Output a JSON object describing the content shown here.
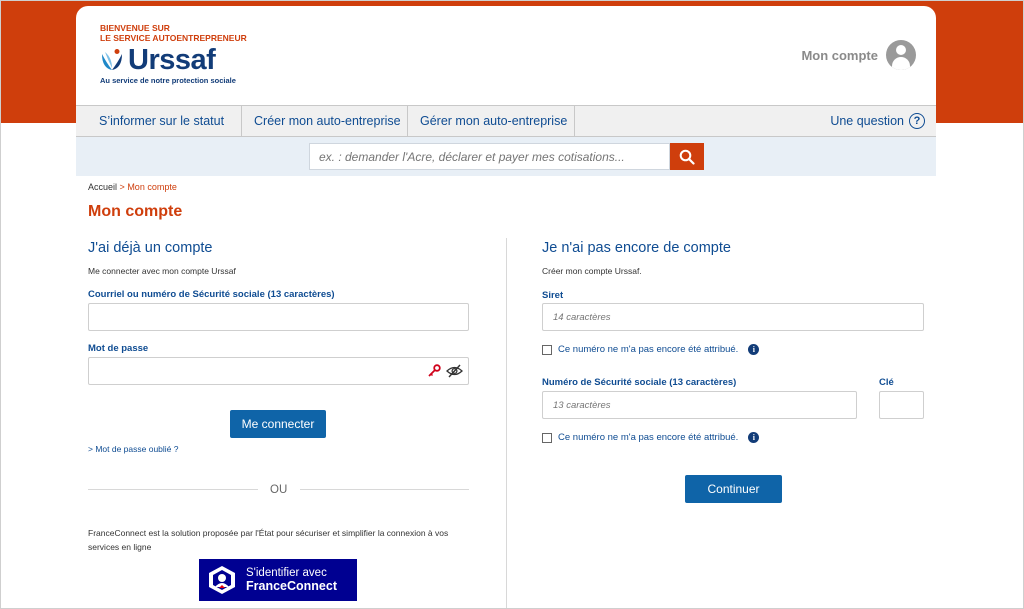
{
  "header": {
    "welcome_line1": "Bienvenue sur",
    "welcome_line2": "le service autoentrepreneur",
    "logo_text": "Urssaf",
    "tagline": "Au service de notre protection sociale",
    "account_label": "Mon compte"
  },
  "nav": {
    "items": [
      {
        "label": "S’informer sur le statut"
      },
      {
        "label": "Créer mon auto-entreprise"
      },
      {
        "label": "Gérer mon auto-entreprise"
      }
    ],
    "question_label": "Une question",
    "question_icon_glyph": "?"
  },
  "search": {
    "placeholder": "ex. : demander l'Acre, déclarer et payer mes cotisations...",
    "icon": "search-icon"
  },
  "breadcrumb": {
    "home": "Accueil",
    "separator": ">",
    "current": "Mon compte"
  },
  "page_title": "Mon compte",
  "login": {
    "heading": "J'ai déjà un compte",
    "intro": "Me connecter avec mon compte Urssaf",
    "email_label": "Courriel ou numéro de Sécurité sociale (13 caractères)",
    "email_value": "",
    "password_label": "Mot de passe",
    "password_value": "",
    "submit_label": "Me connecter",
    "forgot_link": "> Mot de passe oublié ?",
    "or_label": "OU",
    "franceconnect_text": "FranceConnect est la solution proposée par l'État pour sécuriser et simplifier la connexion à vos services en ligne",
    "franceconnect_line1": "S'identifier avec",
    "franceconnect_line2": "FranceConnect"
  },
  "register": {
    "heading": "Je n'ai pas encore de compte",
    "intro": "Créer mon compte Urssaf.",
    "siret_label": "Siret",
    "siret_placeholder": "14 caractères",
    "siret_check_label": "Ce numéro ne m'a pas encore été attribué.",
    "nss_label": "Numéro de Sécurité sociale (13 caractères)",
    "nss_placeholder": "13 caractères",
    "key_label": "Clé",
    "nss_check_label": "Ce numéro ne m'a pas encore été attribué.",
    "info_glyph": "i",
    "submit_label": "Continuer"
  },
  "colors": {
    "brand_orange": "#cf3e0c",
    "brand_blue": "#0f4c92",
    "button_blue": "#0f64a8",
    "franceconnect_blue": "#000091"
  }
}
